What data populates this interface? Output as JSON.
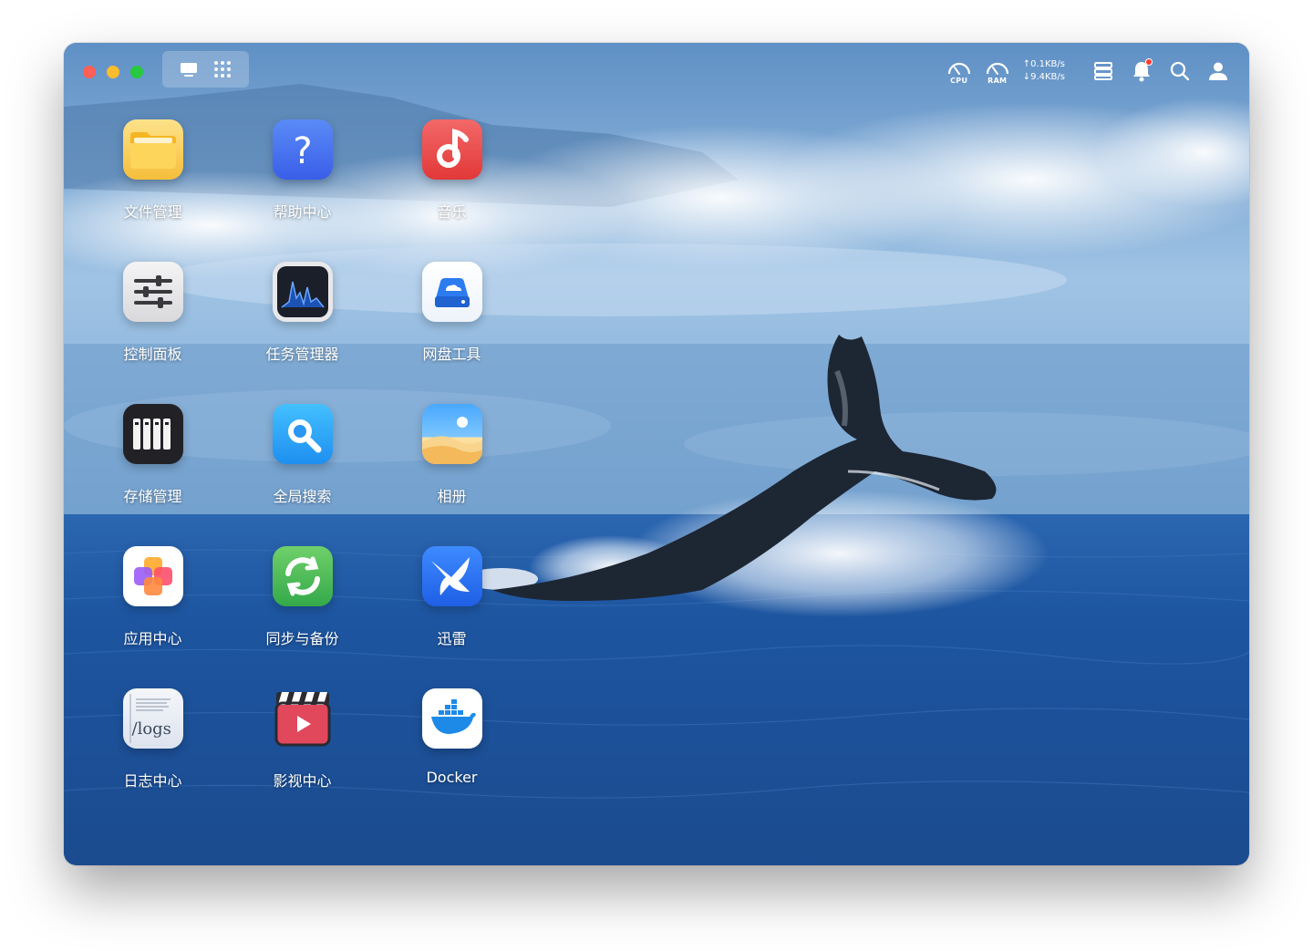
{
  "desktop": {
    "view_switcher": {
      "desktop_icon": "monitor-icon",
      "apps_icon": "grid-icon"
    },
    "tray": {
      "cpu_label": "CPU",
      "ram_label": "RAM",
      "upload": "↑0.1KB/s",
      "download": "↓9.4KB/s",
      "icons": [
        "server-list-icon",
        "bell-icon",
        "search-icon",
        "user-icon"
      ],
      "notification_dot_color": "#ff3b30"
    },
    "apps": [
      {
        "label": "文件管理",
        "icon": "folder-icon"
      },
      {
        "label": "帮助中心",
        "icon": "help-icon"
      },
      {
        "label": "音乐",
        "icon": "music-icon"
      },
      {
        "label": "控制面板",
        "icon": "sliders-icon"
      },
      {
        "label": "任务管理器",
        "icon": "activity-monitor-icon"
      },
      {
        "label": "网盘工具",
        "icon": "cloud-drive-icon"
      },
      {
        "label": "存储管理",
        "icon": "storage-icon"
      },
      {
        "label": "全局搜索",
        "icon": "magnifier-icon"
      },
      {
        "label": "相册",
        "icon": "photos-icon"
      },
      {
        "label": "应用中心",
        "icon": "app-center-icon"
      },
      {
        "label": "同步与备份",
        "icon": "sync-icon"
      },
      {
        "label": "迅雷",
        "icon": "thunder-bird-icon"
      },
      {
        "label": "日志中心",
        "icon": "logs-icon",
        "tile_text": "/logs"
      },
      {
        "label": "影视中心",
        "icon": "clapperboard-icon"
      },
      {
        "label": "Docker",
        "icon": "docker-whale-icon"
      }
    ]
  }
}
